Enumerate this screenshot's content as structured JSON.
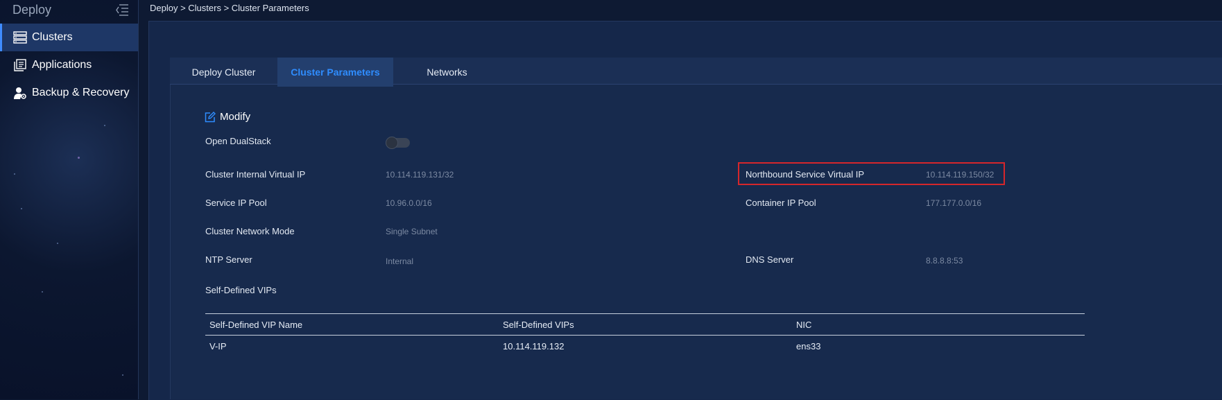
{
  "sidebar": {
    "title": "Deploy",
    "items": [
      {
        "label": "Clusters",
        "icon": "server-list-icon"
      },
      {
        "label": "Applications",
        "icon": "applications-icon"
      },
      {
        "label": "Backup & Recovery",
        "icon": "user-gear-icon"
      }
    ]
  },
  "breadcrumb": "Deploy > Clusters > Cluster Parameters",
  "tabs": [
    {
      "label": "Deploy Cluster"
    },
    {
      "label": "Cluster Parameters"
    },
    {
      "label": "Networks"
    }
  ],
  "modify_label": "Modify",
  "params": {
    "open_dualstack": {
      "label": "Open DualStack",
      "enabled": false
    },
    "cluster_internal_vip": {
      "label": "Cluster Internal Virtual IP",
      "value": "10.114.119.131/32"
    },
    "northbound_vip": {
      "label": "Northbound Service Virtual IP",
      "value": "10.114.119.150/32"
    },
    "service_ip_pool": {
      "label": "Service IP Pool",
      "value": "10.96.0.0/16"
    },
    "container_ip_pool": {
      "label": "Container IP Pool",
      "value": "177.177.0.0/16"
    },
    "network_mode": {
      "label": "Cluster Network Mode",
      "value": "Single Subnet"
    },
    "ntp_server": {
      "label": "NTP Server",
      "value": "Internal"
    },
    "dns_server": {
      "label": "DNS Server",
      "value": "8.8.8.8:53"
    },
    "self_defined_vips": {
      "label": "Self-Defined VIPs"
    }
  },
  "vip_table": {
    "headers": [
      "Self-Defined VIP Name",
      "Self-Defined VIPs",
      "NIC"
    ],
    "rows": [
      [
        "V-IP",
        "10.114.119.132",
        "ens33"
      ]
    ]
  },
  "colors": {
    "accent": "#2f8dff",
    "highlight": "#d6262b"
  }
}
